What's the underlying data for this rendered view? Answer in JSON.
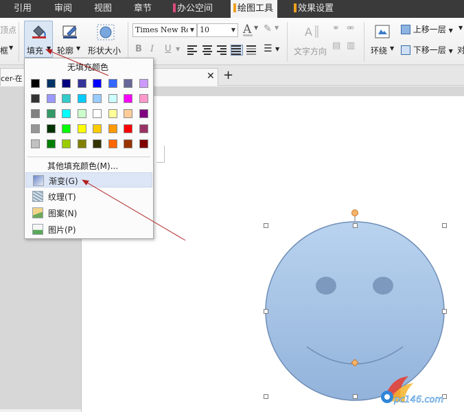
{
  "menu_tabs": [
    "引用",
    "审阅",
    "视图",
    "章节",
    "办公空间",
    "绘图工具",
    "效果设置"
  ],
  "tab_marks": {
    "office": "#d84c78",
    "drawing": "#f0a020",
    "effects": "#f0a020"
  },
  "ribbon": {
    "vertex_partial": "顶点",
    "frame_partial": "框",
    "fill_label": "填充",
    "outline_label": "轮廓",
    "shape_size_label": "形状大小",
    "font_name": "Times New Ror",
    "font_size": "10",
    "bold": "B",
    "italic": "I",
    "underline": "U",
    "text_direction_label": "文字方向",
    "wrap_label": "环绕",
    "bring_forward_label": "上移一层",
    "send_backward_label": "下移一层",
    "align_partial": "对"
  },
  "doc_tab": {
    "title_partial": "cer-在"
  },
  "fill_menu": {
    "no_fill_label": "无填充颜色",
    "palette": [
      [
        "#000000",
        "#003366",
        "#000080",
        "#333399",
        "#0000ff",
        "#3366ff",
        "#666699",
        "#cc99ff"
      ],
      [
        "#333333",
        "#9999ff",
        "#33cccc",
        "#00ccff",
        "#99ccff",
        "#ccffff",
        "#ff00ff",
        "#ff99cc"
      ],
      [
        "#808080",
        "#339966",
        "#00ffff",
        "#ccffcc",
        "#ffffff",
        "#ffff99",
        "#ffcc99",
        "#800080"
      ],
      [
        "#969696",
        "#003300",
        "#00ff00",
        "#ffff00",
        "#ffcc00",
        "#ff9900",
        "#ff0000",
        "#993366"
      ],
      [
        "#c0c0c0",
        "#008000",
        "#99cc00",
        "#808000",
        "#333300",
        "#ff6600",
        "#993300",
        "#800000"
      ]
    ],
    "more_colors_label": "其他填充颜色(M)...",
    "items": [
      {
        "label": "渐变(G)",
        "icon": "gradient-icon"
      },
      {
        "label": "纹理(T)",
        "icon": "texture-icon"
      },
      {
        "label": "图案(N)",
        "icon": "pattern-icon"
      },
      {
        "label": "图片(P)",
        "icon": "picture-icon"
      }
    ]
  },
  "smiley": {
    "fill_top": "#b9d3ef",
    "fill_bottom": "#93b3db",
    "stroke": "#6f8eb7",
    "eye": "#7d99bd"
  },
  "accent_arrow": "#b22222",
  "watermark": "pc146.com"
}
